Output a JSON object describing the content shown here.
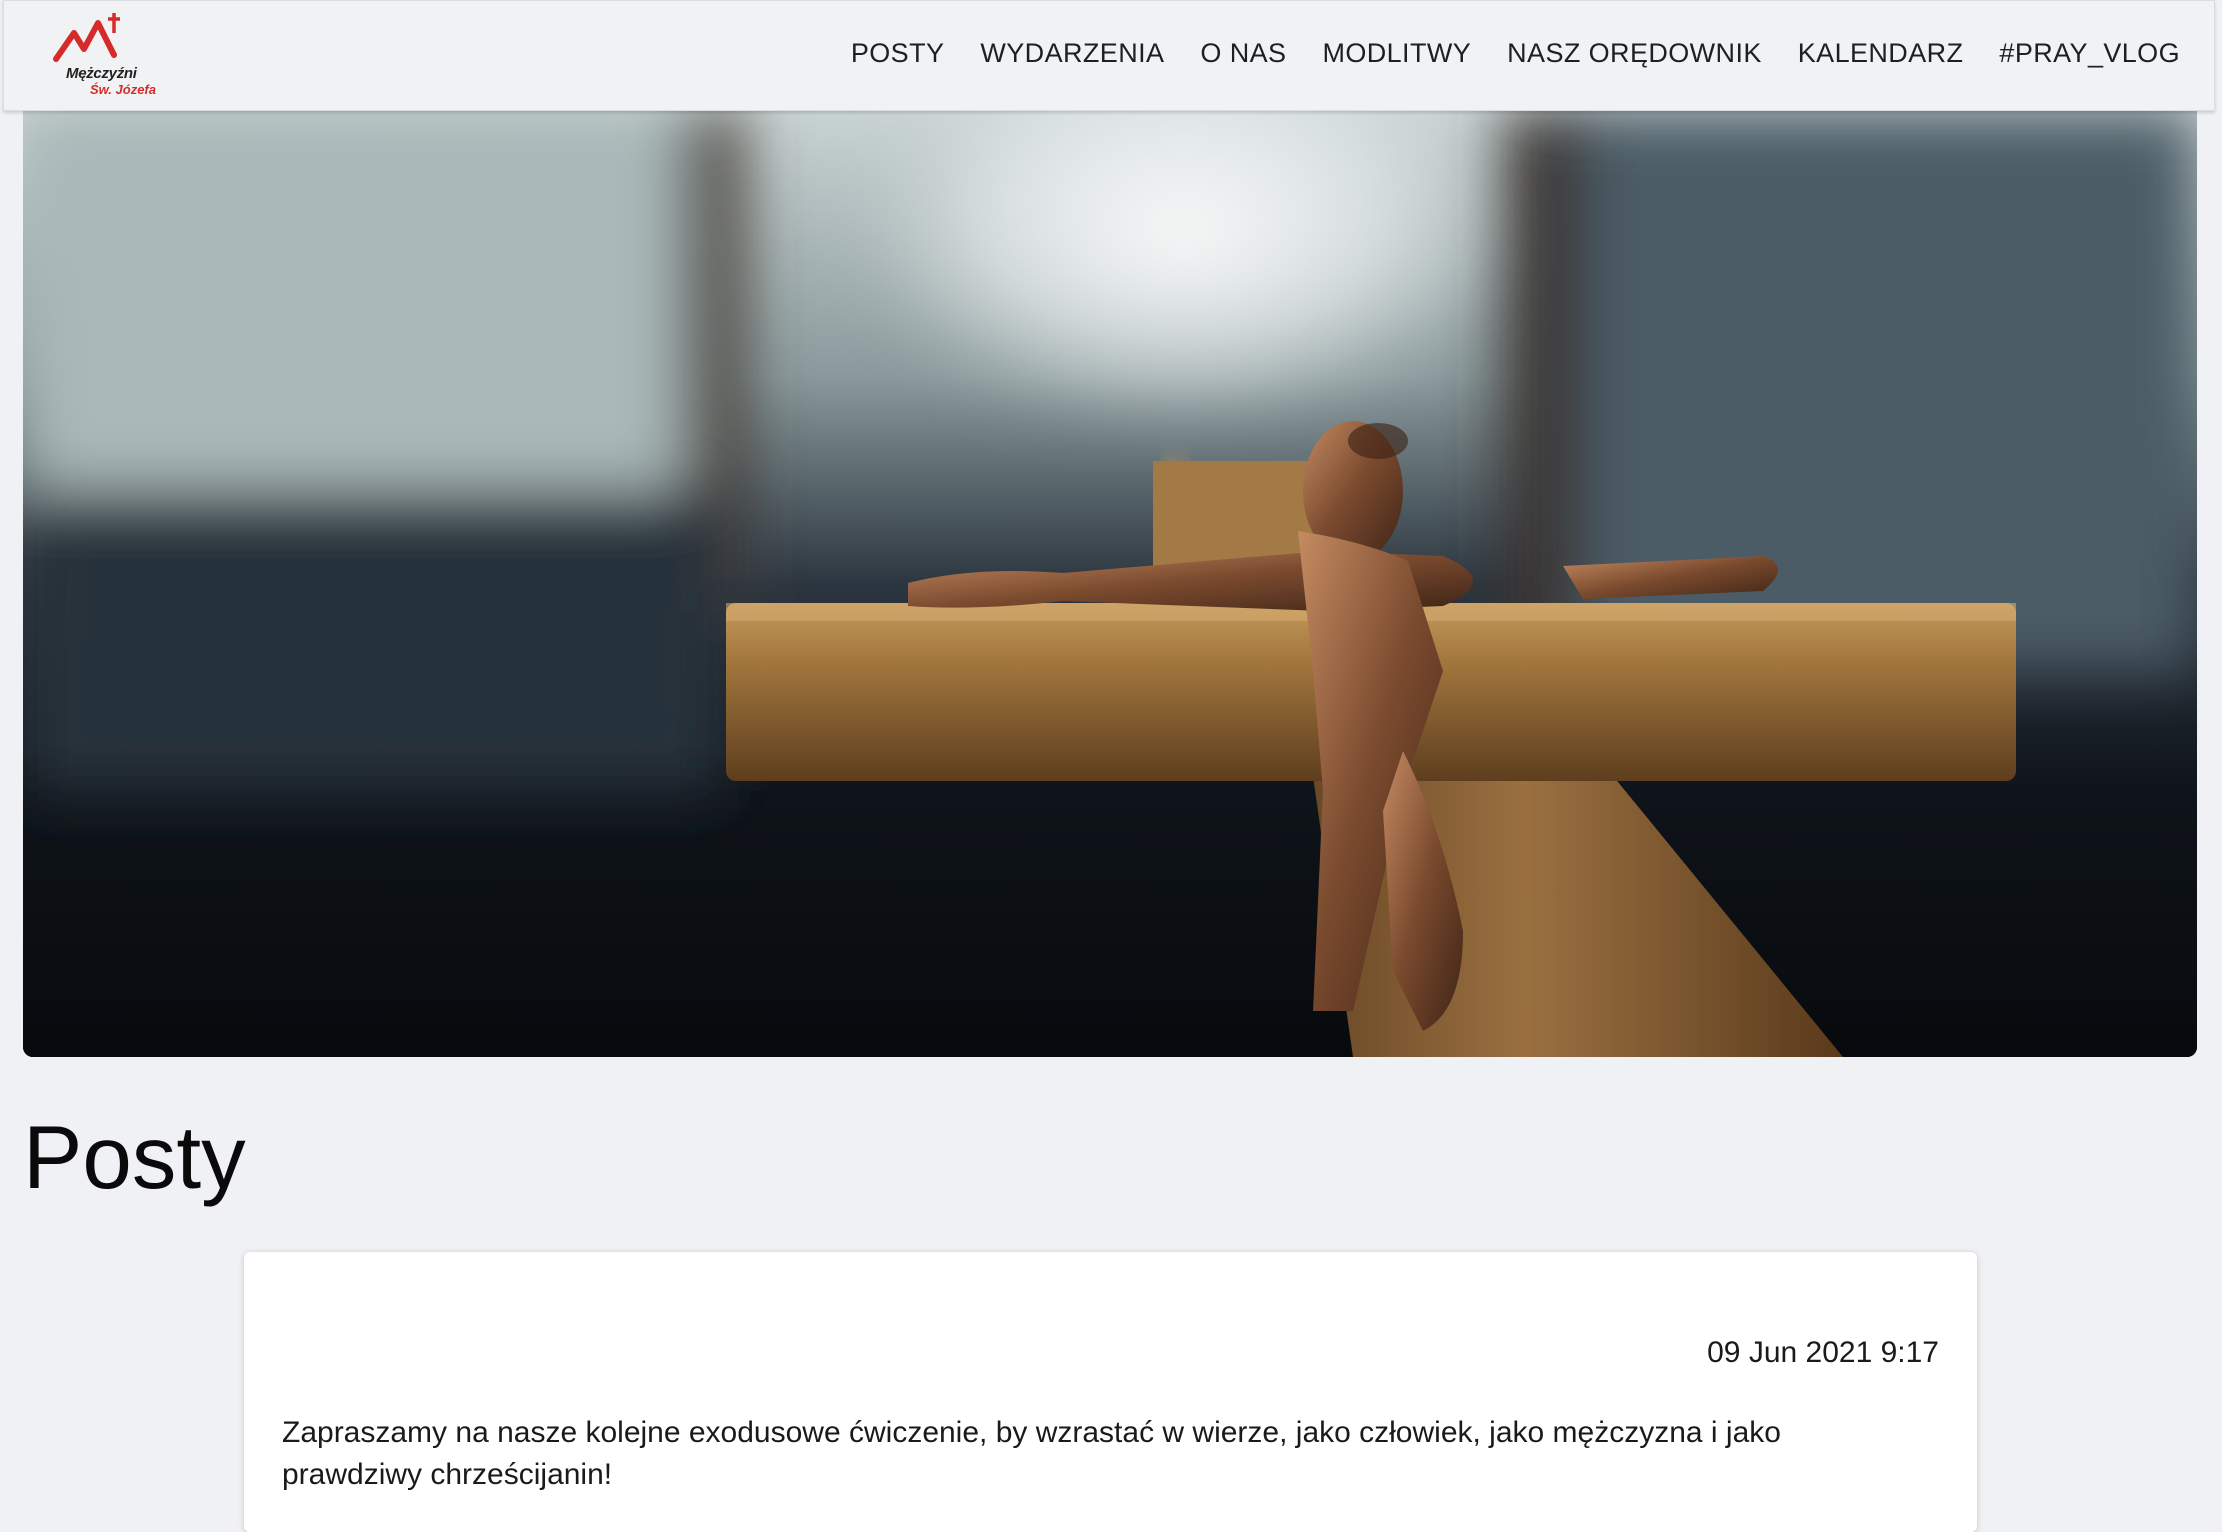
{
  "logo": {
    "line1": "Mężczyźni",
    "line2": "Św. Józefa",
    "brand_red": "#d62b2b"
  },
  "nav": {
    "items": [
      {
        "label": "POSTY"
      },
      {
        "label": "WYDARZENIA"
      },
      {
        "label": "O NAS"
      },
      {
        "label": "MODLITWY"
      },
      {
        "label": "NASZ ORĘDOWNIK"
      },
      {
        "label": "KALENDARZ"
      },
      {
        "label": "#PRAY_VLOG"
      }
    ]
  },
  "hero": {
    "image_subject": "crucifix-photo"
  },
  "main": {
    "title": "Posty"
  },
  "posts": [
    {
      "date": "09 Jun 2021 9:17",
      "text": "Zapraszamy na nasze kolejne exodusowe ćwiczenie, by wzrastać w wierze, jako człowiek, jako mężczyzna i jako prawdziwy chrześcijanin!"
    }
  ]
}
